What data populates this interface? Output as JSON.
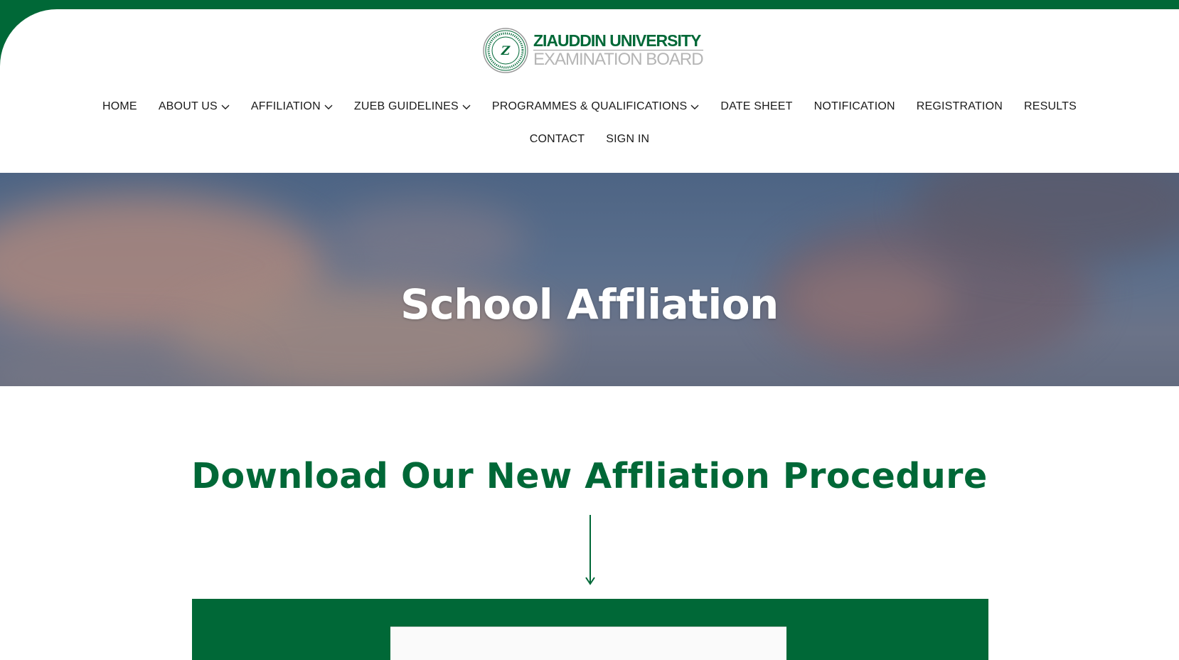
{
  "brand": {
    "name_line1": "ZIAUDDIN UNIVERSITY",
    "name_line2": "EXAMINATION BOARD",
    "seal_mark": "Z",
    "primary_color": "#006837",
    "secondary_color": "#b5b5b5"
  },
  "nav": {
    "row1": [
      {
        "label": "HOME",
        "has_dropdown": false
      },
      {
        "label": "ABOUT US",
        "has_dropdown": true
      },
      {
        "label": "AFFILIATION",
        "has_dropdown": true
      },
      {
        "label": "ZUEB GUIDELINES",
        "has_dropdown": true
      },
      {
        "label": "PROGRAMMES & QUALIFICATIONS",
        "has_dropdown": true
      },
      {
        "label": "DATE SHEET",
        "has_dropdown": false
      },
      {
        "label": "NOTIFICATION",
        "has_dropdown": false
      },
      {
        "label": "REGISTRATION",
        "has_dropdown": false
      },
      {
        "label": "RESULTS",
        "has_dropdown": false
      }
    ],
    "row2": [
      {
        "label": "CONTACT",
        "has_dropdown": false
      },
      {
        "label": "SIGN IN",
        "has_dropdown": false
      }
    ]
  },
  "hero": {
    "title": "School Affliation"
  },
  "download": {
    "heading": "Download Our New Affliation Procedure",
    "arrow_icon": "arrow-down-icon"
  }
}
